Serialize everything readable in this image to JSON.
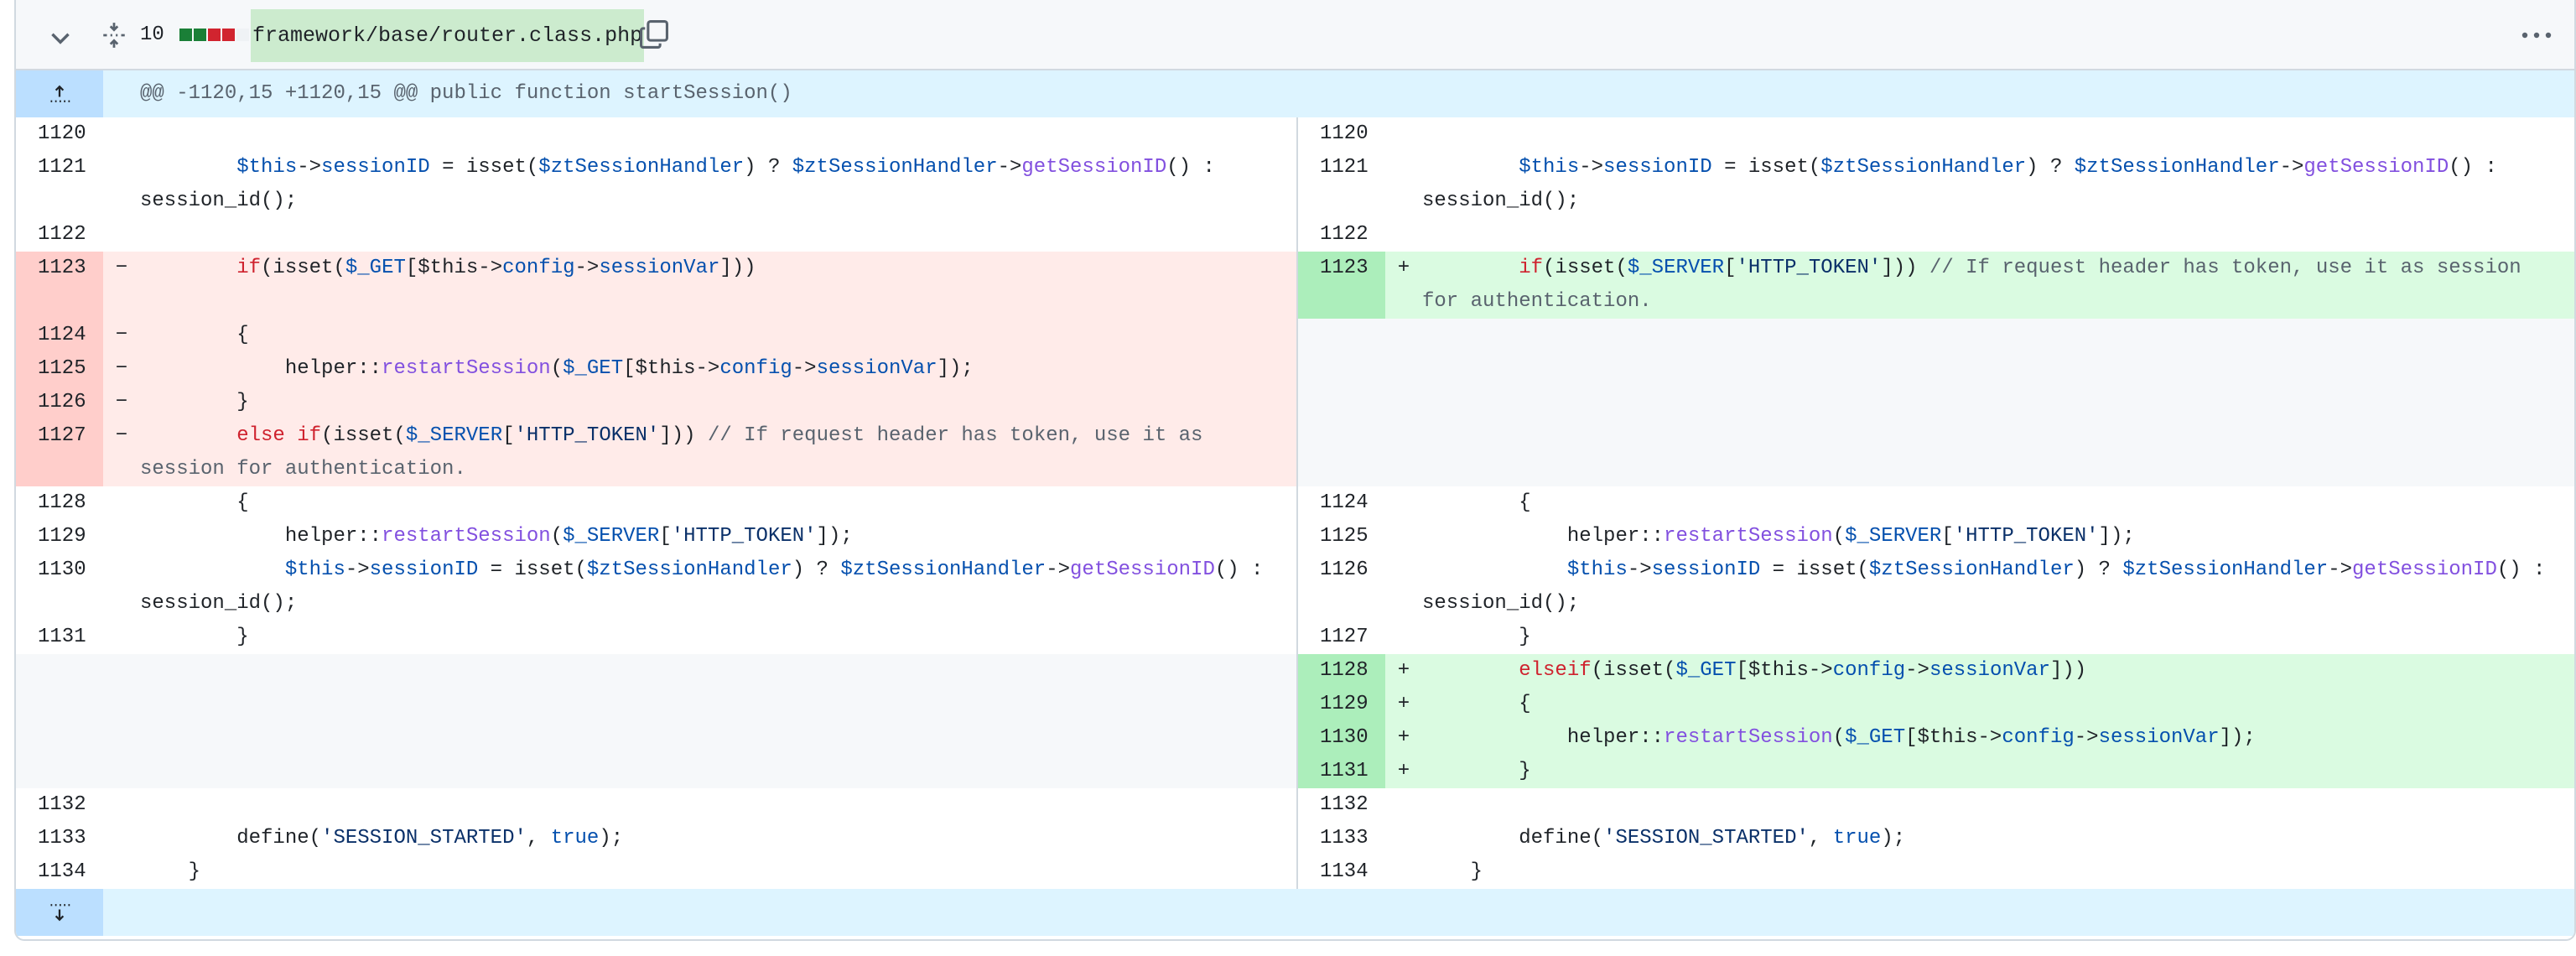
{
  "file": {
    "changes_count": "10",
    "filename": "framework/base/router.class.php",
    "diffstat_colors": [
      "#1a7f37",
      "#1a7f37",
      "#d1242f",
      "#d1242f",
      "#eff2f5"
    ]
  },
  "icons": {
    "collapse": "chevron-down-icon",
    "expand_all": "fold-icon",
    "copy": "copy-icon",
    "menu": "kebab-horizontal-icon",
    "expand_up": "expand-up-icon",
    "expand_down": "expand-down-icon"
  },
  "hunk": {
    "header": "@@ -1120,15 +1120,15 @@ public function startSession()"
  },
  "rows": [
    {
      "type": "ctx",
      "l": "1120",
      "r": "1120"
    },
    {
      "type": "ctx",
      "l": "1121",
      "r": "1121"
    },
    {
      "type": "ctx",
      "l": "1122",
      "r": "1122"
    },
    {
      "type": "chg",
      "l": "1123",
      "r": "1123"
    },
    {
      "type": "del",
      "l": "1124"
    },
    {
      "type": "del",
      "l": "1125"
    },
    {
      "type": "del",
      "l": "1126"
    },
    {
      "type": "del",
      "l": "1127"
    },
    {
      "type": "ctx",
      "l": "1128",
      "r": "1124"
    },
    {
      "type": "ctx",
      "l": "1129",
      "r": "1125"
    },
    {
      "type": "ctx",
      "l": "1130",
      "r": "1126"
    },
    {
      "type": "ctx",
      "l": "1131",
      "r": "1127"
    },
    {
      "type": "add",
      "r": "1128"
    },
    {
      "type": "add",
      "r": "1129"
    },
    {
      "type": "add",
      "r": "1130"
    },
    {
      "type": "add",
      "r": "1131"
    },
    {
      "type": "ctx",
      "l": "1132",
      "r": "1132"
    },
    {
      "type": "ctx",
      "l": "1133",
      "r": "1133"
    },
    {
      "type": "ctx",
      "l": "1134",
      "r": "1134"
    }
  ],
  "code": {
    "c1121_a": "        ",
    "this": "$this",
    "arrow": "->",
    "sessionID": "sessionID",
    "eq_isset": " = isset(",
    "handler": "$ztSessionHandler",
    "q": ") ? ",
    "getSessionID": "getSessionID",
    "tail": "() :",
    "session_id": "session_id();",
    "if": "if",
    "isset_open": "(isset(",
    "get": "$_GET",
    "br_open": "[",
    "config": "config",
    "sessionVar": "sessionVar",
    "br_close3": "]))",
    "brace_open": "{",
    "brace_close": "}",
    "helper": "helper::",
    "restartSession": "restartSession",
    "paren_open": "(",
    "close_semicolon": "]);",
    "else_if": "else if",
    "elseif": "elseif",
    "server": "$_SERVER",
    "http_token": "'HTTP_TOKEN'",
    "br_close2": "]))",
    "comment_full": "// If request header has token, use it as session for authentication.",
    "define": "define(",
    "session_started": "'SESSION_STARTED'",
    "comma": ", ",
    "true": "true",
    "define_close": ");",
    "minus": "−",
    "plus": "+"
  }
}
